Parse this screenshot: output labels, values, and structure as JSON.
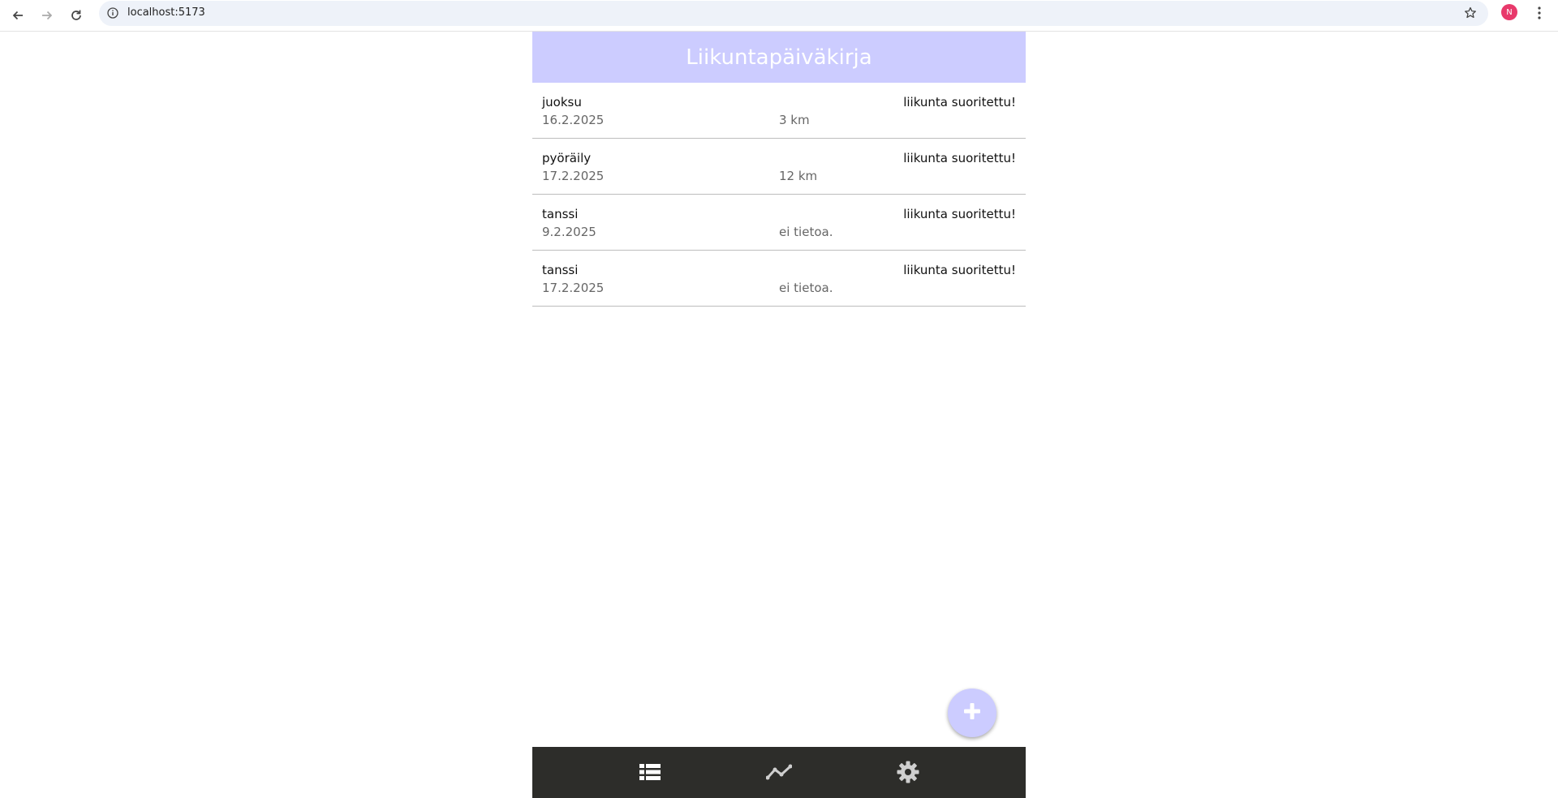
{
  "browser": {
    "url": "localhost:5173",
    "profile_initial": "N",
    "profile_color": "#e8396b",
    "icons": [
      "back-arrow-icon",
      "forward-arrow-icon",
      "reload-icon",
      "info-icon",
      "bookmark-star-icon",
      "kebab-menu-icon"
    ]
  },
  "app": {
    "title": "Liikuntapäiväkirja",
    "header_color": "#ccccff",
    "nav_color": "#2d2d2a",
    "entries": [
      {
        "name": "juoksu",
        "date": "16.2.2025",
        "distance": "3 km",
        "status": "liikunta suoritettu!"
      },
      {
        "name": "pyöräily",
        "date": "17.2.2025",
        "distance": "12 km",
        "status": "liikunta suoritettu!"
      },
      {
        "name": "tanssi",
        "date": "9.2.2025",
        "distance": "ei tietoa.",
        "status": "liikunta suoritettu!"
      },
      {
        "name": "tanssi",
        "date": "17.2.2025",
        "distance": "ei tietoa.",
        "status": "liikunta suoritettu!"
      }
    ],
    "fab_icon": "plus-icon",
    "nav_icons": [
      "list-icon",
      "chart-line-icon",
      "gear-icon"
    ]
  }
}
